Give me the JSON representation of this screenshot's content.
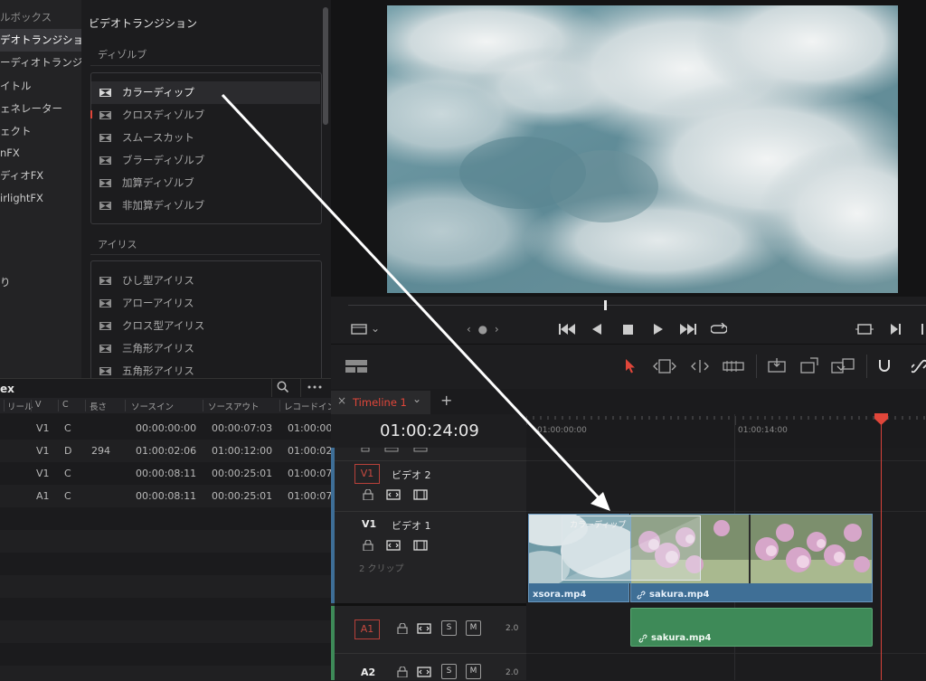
{
  "categories": [
    {
      "label": "ルボックス",
      "selected": false,
      "dim": true
    },
    {
      "label": "デオトランジション",
      "selected": true
    },
    {
      "label": "ーディオトランジ...",
      "selected": false
    },
    {
      "label": "イトル",
      "selected": false
    },
    {
      "label": "ェネレーター",
      "selected": false
    },
    {
      "label": "ェクト",
      "selected": false
    },
    {
      "label": "nFX",
      "selected": false
    },
    {
      "label": "ディオFX",
      "selected": false
    },
    {
      "label": "irlightFX",
      "selected": false
    },
    {
      "label": "り",
      "selected": false
    }
  ],
  "effects": {
    "title": "ビデオトランジション",
    "group1": {
      "header": "ディゾルブ",
      "items": [
        "カラーディップ",
        "クロスディゾルブ",
        "スムースカット",
        "ブラーディゾルブ",
        "加算ディゾルブ",
        "非加算ディゾルブ"
      ]
    },
    "group2": {
      "header": "アイリス",
      "items": [
        "ひし型アイリス",
        "アローアイリス",
        "クロス型アイリス",
        "三角形アイリス",
        "五角形アイリス"
      ]
    }
  },
  "index": {
    "title": "ex",
    "columns": [
      "リール",
      "V",
      "C",
      "長さ",
      "ソースイン",
      "ソースアウト",
      "レコードイン"
    ],
    "rows": [
      {
        "v": "V1",
        "c": "C",
        "len": "",
        "src_in": "00:00:00:00",
        "src_out": "00:00:07:03",
        "rec_in": "01:00:00:"
      },
      {
        "v": "V1",
        "c": "D",
        "len": "294",
        "src_in": "01:00:02:06",
        "src_out": "01:00:12:00",
        "rec_in": "01:00:02"
      },
      {
        "v": "V1",
        "c": "C",
        "len": "",
        "src_in": "00:00:08:11",
        "src_out": "00:00:25:01",
        "rec_in": "01:00:07:"
      },
      {
        "v": "A1",
        "c": "C",
        "len": "",
        "src_in": "00:00:08:11",
        "src_out": "00:00:25:01",
        "rec_in": "01:00:07:"
      }
    ]
  },
  "timeline": {
    "tab_label": "Timeline 1",
    "close_glyph": "×",
    "dropdown_glyph": "⌄",
    "add_glyph": "+",
    "timecode": "01:00:24:09",
    "ruler_labels": [
      "01:00:00:00",
      "01:00:14:00"
    ],
    "tracks": {
      "v2": {
        "id": "V1",
        "name": "ビデオ 2"
      },
      "v1": {
        "id": "V1",
        "name": "ビデオ 1",
        "clip_count": "2 クリップ"
      },
      "a1": {
        "id": "A1",
        "level": "2.0"
      },
      "a2": {
        "id": "A2",
        "level": "2.0"
      }
    },
    "clips": {
      "clip1": "xsora.mp4",
      "clip2": "sakura.mp4",
      "transition": "カラーディップ",
      "audio": "sakura.mp4"
    },
    "s_label": "S",
    "m_label": "M"
  },
  "transport": {
    "nav_text": "‹ ● ›",
    "dropdown_glyph": "⌄"
  },
  "colors": {
    "accent_red": "#e0463a",
    "video_clip": "#3f6f96",
    "audio_clip": "#3e8a58",
    "arrow": "#ffffff"
  }
}
